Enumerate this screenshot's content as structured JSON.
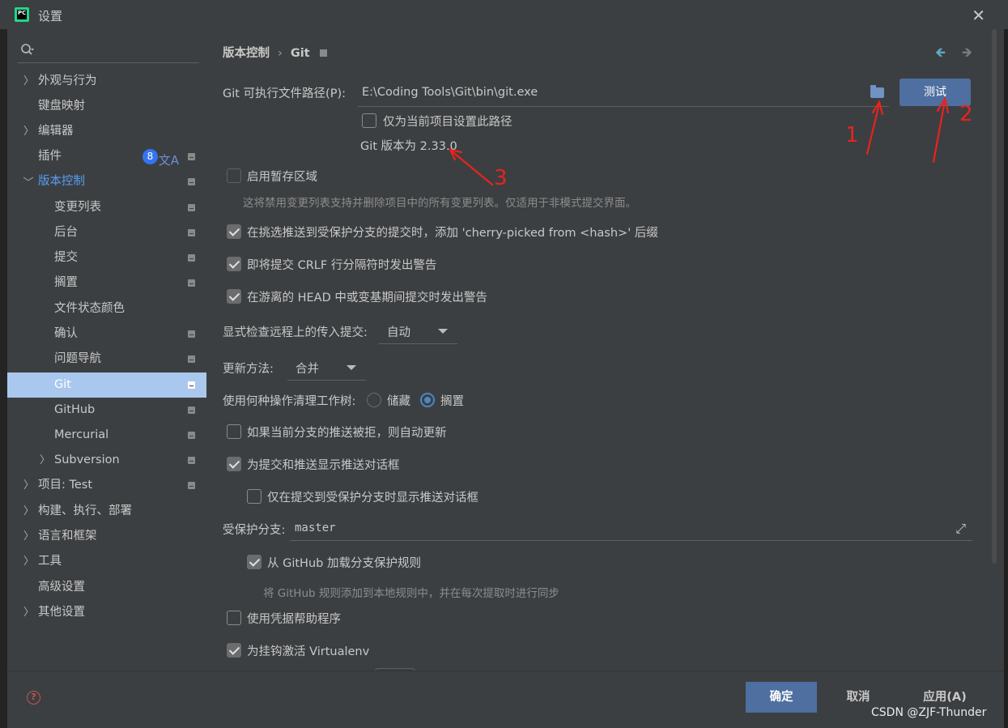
{
  "window": {
    "title": "设置",
    "logo_text": "PC"
  },
  "sidebar": {
    "search_placeholder": "",
    "items": [
      {
        "label": "外观与行为",
        "expandable": true
      },
      {
        "label": "键盘映射"
      },
      {
        "label": "编辑器",
        "expandable": true
      },
      {
        "label": "插件",
        "badge": "8"
      },
      {
        "label": "版本控制",
        "expanded": true
      },
      {
        "label": "变更列表"
      },
      {
        "label": "后台"
      },
      {
        "label": "提交"
      },
      {
        "label": "搁置"
      },
      {
        "label": "文件状态颜色"
      },
      {
        "label": "确认"
      },
      {
        "label": "问题导航"
      },
      {
        "label": "Git",
        "selected": true
      },
      {
        "label": "GitHub"
      },
      {
        "label": "Mercurial"
      },
      {
        "label": "Subversion",
        "expandable": true
      },
      {
        "label": "项目: Test",
        "expandable": true
      },
      {
        "label": "构建、执行、部署",
        "expandable": true
      },
      {
        "label": "语言和框架",
        "expandable": true
      },
      {
        "label": "工具",
        "expandable": true
      },
      {
        "label": "高级设置"
      },
      {
        "label": "其他设置",
        "expandable": true
      }
    ]
  },
  "breadcrumb": {
    "parent": "版本控制",
    "current": "Git"
  },
  "git": {
    "path_label": "Git 可执行文件路径(P):",
    "path_value": "E:\\Coding Tools\\Git\\bin\\git.exe",
    "test_button": "测试",
    "project_only_label": "仅为当前项目设置此路径",
    "version_text": "Git 版本为 2.33.0"
  },
  "options": {
    "staging_label": "启用暂存区域",
    "staging_hint": "这将禁用变更列表支持并删除项目中的所有变更列表。仅适用于非模式提交界面。",
    "cherry_label": "在挑选推送到受保护分支的提交时，添加 'cherry-picked from <hash>' 后缀",
    "crlf_label": "即将提交 CRLF 行分隔符时发出警告",
    "detached_label": "在游离的 HEAD 中或变基期间提交时发出警告",
    "incoming_label": "显式检查远程上的传入提交:",
    "incoming_value": "自动",
    "update_label": "更新方法:",
    "update_value": "合并",
    "clean_label": "使用何种操作清理工作树:",
    "clean_opt1": "储藏",
    "clean_opt2": "搁置",
    "auto_update_label": "如果当前分支的推送被拒，则自动更新",
    "push_dialog_label": "为提交和推送显示推送对话框",
    "push_protected_label": "仅在提交到受保护分支时显示推送对话框",
    "protected_label": "受保护分支:",
    "protected_value": "master",
    "github_rules_label": "从 GitHub 加载分支保护规则",
    "github_rules_hint": "将 GitHub 规则添加到本地规则中，并在每次提取时进行同步",
    "credential_label": "使用凭据帮助程序",
    "virtualenv_label": "为挂钩激活 Virtualenv"
  },
  "footer": {
    "ok": "确定",
    "cancel": "取消",
    "apply": "应用(A)"
  },
  "annotations": {
    "a1": "1",
    "a2": "2",
    "a3": "3",
    "color": "#e8231d"
  },
  "watermark": "CSDN @ZJF-Thunder"
}
